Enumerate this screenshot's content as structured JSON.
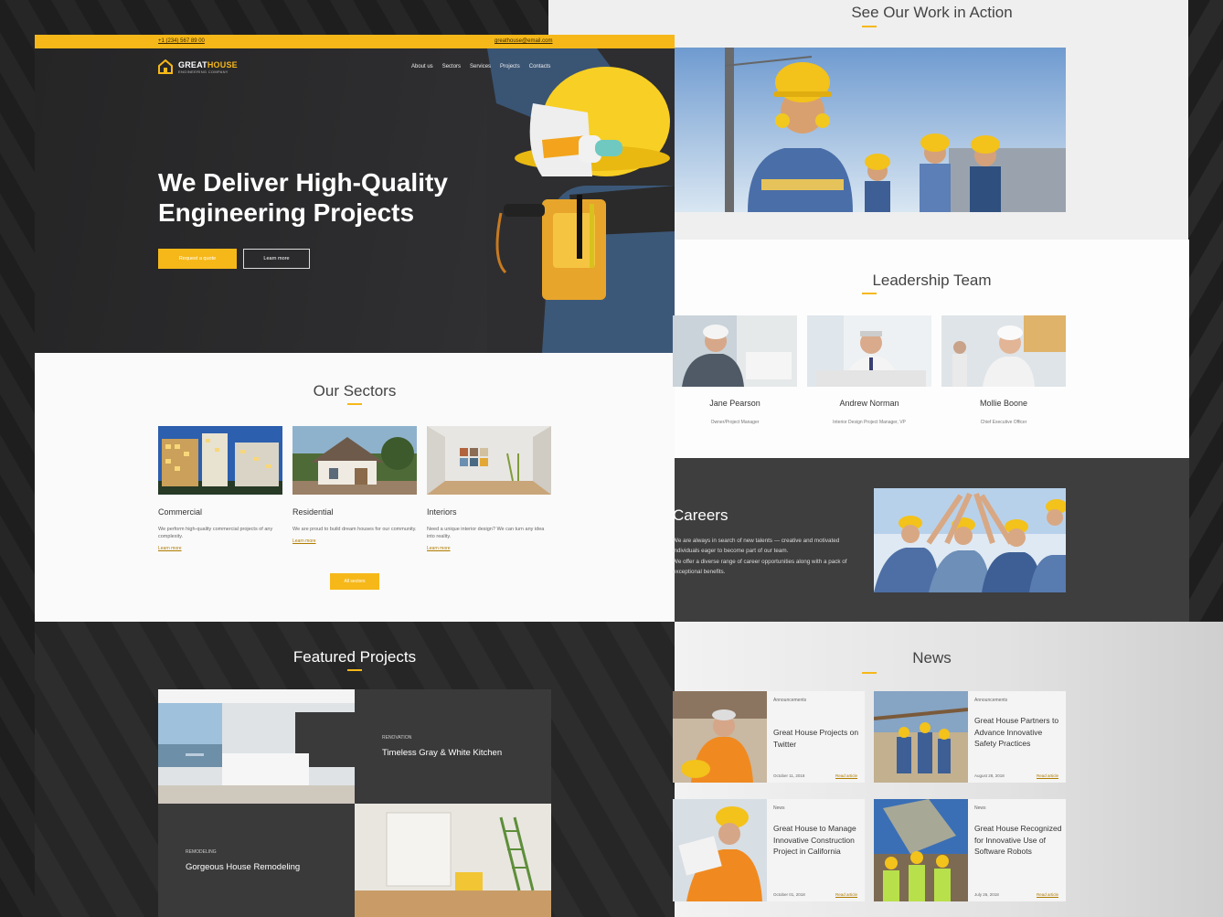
{
  "topbar": {
    "phone": "+1 (234) 567 89 00",
    "email": "greathouse@email.com"
  },
  "brand": {
    "name_part1": "GREAT",
    "name_part2": "HOUSE",
    "tagline": "ENGINEERING COMPANY",
    "accent": "#f6b819"
  },
  "nav": [
    "About us",
    "Sectors",
    "Services",
    "Projects",
    "Contacts"
  ],
  "hero": {
    "title_line1": "We Deliver High-Quality",
    "title_line2": "Engineering Projects",
    "primary_button": "Request a quote",
    "secondary_button": "Learn more"
  },
  "sectors": {
    "title": "Our Sectors",
    "items": [
      {
        "name": "Commercial",
        "desc": "We perform high-quality commercial projects of any complexity.",
        "link": "Learn more"
      },
      {
        "name": "Residential",
        "desc": "We are proud to build dream houses for our community.",
        "link": "Learn more"
      },
      {
        "name": "Interiors",
        "desc": "Need a unique interior design? We can turn any idea into reality.",
        "link": "Learn more"
      }
    ],
    "all_button": "All sectors"
  },
  "featured": {
    "title": "Featured Projects",
    "items": [
      {
        "category": "RENOVATION",
        "name": "Timeless Gray & White Kitchen"
      },
      {
        "category": "REMODELING",
        "name": "Gorgeous House Remodeling"
      }
    ]
  },
  "action": {
    "title": "See Our Work in Action"
  },
  "leadership": {
    "title": "Leadership Team",
    "members": [
      {
        "name": "Jane Pearson",
        "role": "Owner/Project Manager"
      },
      {
        "name": "Andrew Norman",
        "role": "Interior Design Project Manager, VP"
      },
      {
        "name": "Mollie Boone",
        "role": "Chief Executive Officer"
      }
    ]
  },
  "careers": {
    "title": "Careers",
    "text": "We are always in search of new talents — creative and motivated individuals eager to become part of our team.\nWe offer a diverse range of career opportunities along with a pack of exceptional benefits."
  },
  "news": {
    "title": "News",
    "items": [
      {
        "category": "Announcements",
        "title": "Great House Projects on Twitter",
        "date": "October 11, 2018",
        "link": "Read article"
      },
      {
        "category": "Announcements",
        "title": "Great House Partners to Advance Innovative Safety Practices",
        "date": "August 28, 2018",
        "link": "Read article"
      },
      {
        "category": "News",
        "title": "Great House to Manage Innovative Construction Project in California",
        "date": "October 01, 2018",
        "link": "Read article"
      },
      {
        "category": "News",
        "title": "Great House Recognized for Innovative Use of Software Robots",
        "date": "July 26, 2018",
        "link": "Read article"
      }
    ]
  }
}
